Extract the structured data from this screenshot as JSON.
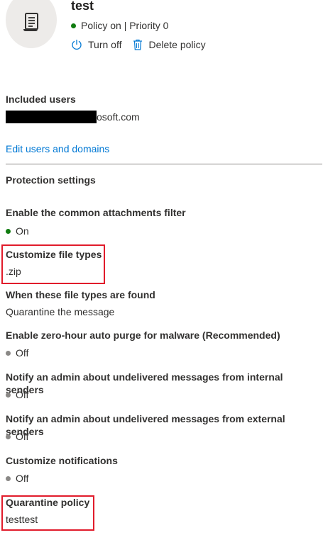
{
  "header": {
    "title": "test",
    "status": "Policy on | Priority 0",
    "actions": {
      "turn_off_label": "Turn off",
      "delete_label": "Delete policy"
    }
  },
  "included_users": {
    "label": "Included users",
    "value_visible_suffix": "osoft.com",
    "edit_link": "Edit users and domains"
  },
  "protection_settings": {
    "heading": "Protection settings",
    "items": [
      {
        "label": "Enable the common attachments filter",
        "value": "On",
        "status": "on"
      },
      {
        "label": "Customize file types",
        "value": ".zip"
      },
      {
        "label": "When these file types are found",
        "value": "Quarantine the message"
      },
      {
        "label": "Enable zero-hour auto purge for malware (Recommended)",
        "value": "Off",
        "status": "off"
      },
      {
        "label": "Notify an admin about undelivered messages from internal senders",
        "value": "Off",
        "status": "off"
      },
      {
        "label": "Notify an admin about undelivered messages from external senders",
        "value": "Off",
        "status": "off"
      },
      {
        "label": "Customize notifications",
        "value": "Off",
        "status": "off"
      },
      {
        "label": "Quarantine policy",
        "value": "testtest"
      }
    ]
  },
  "colors": {
    "status_on": "#107c10",
    "status_off": "#8a8886",
    "link": "#0078d4",
    "highlight": "#e11b2b"
  },
  "icons": {
    "avatar": "scroll-icon",
    "turn_off": "power-icon",
    "delete": "trash-icon"
  }
}
